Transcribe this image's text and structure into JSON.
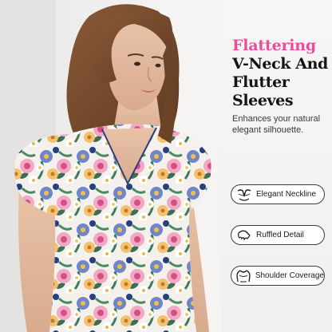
{
  "headline": {
    "accent": "Flattering",
    "lines": [
      "V-Neck And",
      "Flutter",
      "Sleeves"
    ],
    "accent_color": "#ea4d9c"
  },
  "subtitle": "Enhances your natural elegant silhouette.",
  "features": [
    {
      "label": "Elegant Neckline",
      "icon": "neckline-icon"
    },
    {
      "label": "Ruffled Detail",
      "icon": "ruffle-icon"
    },
    {
      "label": "Shoulder Coverage",
      "icon": "shoulder-icon"
    }
  ],
  "photo": {
    "subject": "model-in-floral-v-neck-dress"
  }
}
